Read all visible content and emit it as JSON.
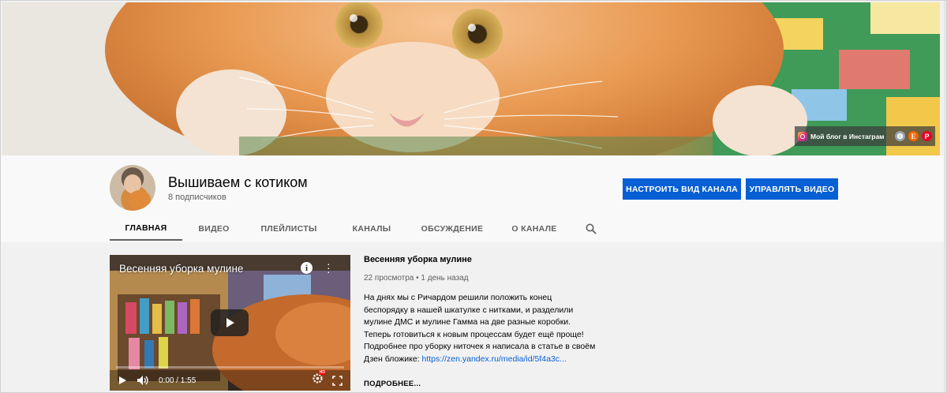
{
  "banner": {
    "links_label": "Мой блог в Инстаграм"
  },
  "channel": {
    "title": "Вышиваем с котиком",
    "subscribers": "8 подписчиков",
    "customize_button": "НАСТРОИТЬ ВИД КАНАЛА",
    "manage_button": "УПРАВЛЯТЬ ВИДЕО"
  },
  "tabs": [
    {
      "label": "ГЛАВНАЯ",
      "active": true
    },
    {
      "label": "ВИДЕО",
      "active": false
    },
    {
      "label": "ПЛЕЙЛИСТЫ",
      "active": false
    },
    {
      "label": "КАНАЛЫ",
      "active": false
    },
    {
      "label": "ОБСУЖДЕНИЕ",
      "active": false
    },
    {
      "label": "О КАНАЛЕ",
      "active": false
    }
  ],
  "player": {
    "overlay_title": "Весенняя уборка мулине",
    "info_glyph": "i",
    "time": "0:00 / 1:55",
    "hd_badge": "HD"
  },
  "video": {
    "title": "Весенняя уборка мулине",
    "meta": "22 просмотра • 1 день назад",
    "description_lines": [
      "На днях мы с Ричардом решили положить конец",
      "беспорядку в нашей шкатулке с нитками, и разделили",
      "мулине ДМС и мулине Гамма на две разные коробки.",
      "Теперь готовиться к новым процессам будет ещё проще!",
      "Подробнее про уборку ниточек я написала в статье в своём"
    ],
    "description_last_prefix": "Дзен бложике: ",
    "description_link": "https://zen.yandex.ru/media/id/5f4a3c...",
    "more": "ПОДРОБНЕЕ..."
  },
  "icons": {
    "instagram": "instagram-icon",
    "website": "globe-icon",
    "etsy": "etsy-icon",
    "pinterest": "pinterest-icon",
    "search": "search-icon",
    "play": "play-icon",
    "volume": "volume-icon",
    "settings": "settings-icon",
    "fullscreen": "fullscreen-icon"
  },
  "colors": {
    "accent": "#065fd4",
    "tab_inactive": "#606060",
    "link": "#065fd4"
  }
}
